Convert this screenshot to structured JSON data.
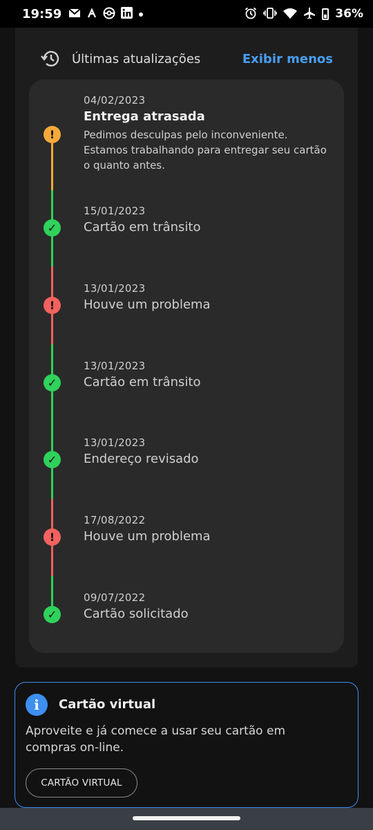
{
  "status_bar": {
    "time": "19:59",
    "left_icons": [
      "gmail-icon",
      "notification-icon",
      "pokeball-icon",
      "linkedin-icon",
      "dot-icon"
    ],
    "right_icons": [
      "alarm-icon",
      "vibrate-icon",
      "wifi-icon",
      "airplane-icon",
      "battery-icon"
    ],
    "battery": "36%"
  },
  "updates": {
    "title": "Últimas atualizações",
    "toggle_label": "Exibir menos",
    "events": [
      {
        "date": "04/02/2023",
        "title": "Entrega atrasada",
        "description": "Pedimos desculpas pelo inconveniente. Estamos trabalhando para entregar seu cartão o quanto antes.",
        "status": "warning",
        "color": "#f4a93a"
      },
      {
        "date": "15/01/2023",
        "title": "Cartão em trânsito",
        "status": "success",
        "color": "#2fd25a"
      },
      {
        "date": "13/01/2023",
        "title": "Houve um problema",
        "status": "error",
        "color": "#f2625f"
      },
      {
        "date": "13/01/2023",
        "title": "Cartão em trânsito",
        "status": "success",
        "color": "#2fd25a"
      },
      {
        "date": "13/01/2023",
        "title": "Endereço revisado",
        "status": "success",
        "color": "#2fd25a"
      },
      {
        "date": "17/08/2022",
        "title": "Houve um problema",
        "status": "error",
        "color": "#f2625f"
      },
      {
        "date": "09/07/2022",
        "title": "Cartão solicitado",
        "status": "success",
        "color": "#2fd25a"
      }
    ]
  },
  "virtual_card": {
    "title": "Cartão virtual",
    "text": "Aproveite e já comece a usar seu cartão em compras on-line.",
    "button_label": "CARTÃO VIRTUAL",
    "accent_color": "#3d8ff0"
  }
}
